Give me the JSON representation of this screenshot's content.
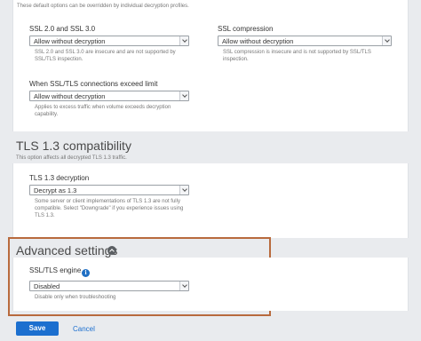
{
  "top_desc": "These default options can be overridden by individual decryption profiles.",
  "ssl2": {
    "label": "SSL 2.0 and SSL 3.0",
    "value": "Allow without decryption",
    "help_line1": "SSL 2.0 and SSL 3.0 are insecure and are not supported by",
    "help_line2": "SSL/TLS inspection."
  },
  "ssl_compression": {
    "label": "SSL compression",
    "value": "Allow without decryption",
    "help_line1": "SSL compression is insecure and is not supported by SSL/TLS",
    "help_line2": "inspection."
  },
  "ssl_limit": {
    "label": "When SSL/TLS connections exceed limit",
    "value": "Allow without decryption",
    "help_line1": "Applies to excess traffic when volume exceeds decryption",
    "help_line2": "capability."
  },
  "tls13": {
    "title": "TLS 1.3 compatibility",
    "desc": "This option affects all decrypted TLS 1.3 traffic.",
    "label": "TLS 1.3 decryption",
    "value": "Decrypt as 1.3",
    "help_line1": "Some server or client implementations of TLS 1.3 are not fully",
    "help_line2": "compatible. Select \"Downgrade\" if you experience issues using",
    "help_line3": "TLS 1.3."
  },
  "advanced": {
    "title": "Advanced settings",
    "label": "SSL/TLS engine",
    "value": "Disabled",
    "help": "Disable only when troubleshooting"
  },
  "actions": {
    "save": "Save",
    "cancel": "Cancel"
  },
  "colors": {
    "primary": "#1c6fcf",
    "highlight_border": "#b86a3d",
    "background": "#e9ebee"
  }
}
